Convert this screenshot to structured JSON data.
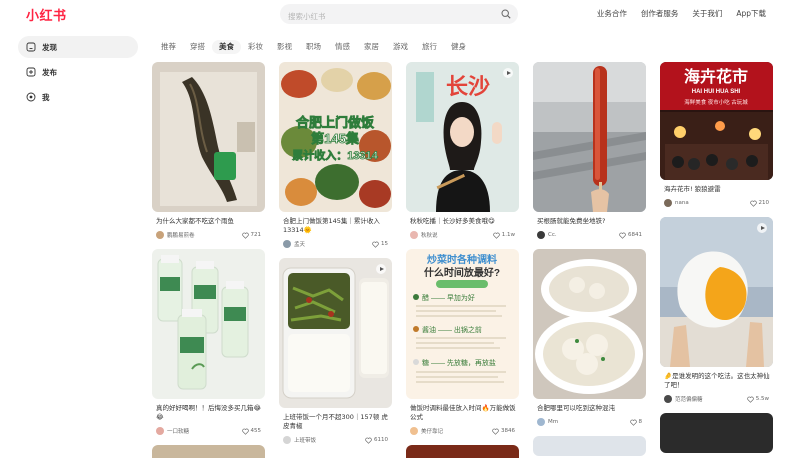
{
  "brand": "小红书",
  "search": {
    "placeholder": "搜索小红书"
  },
  "topnav": [
    "业务合作",
    "创作者服务",
    "关于我们",
    "App下载"
  ],
  "sidebar": [
    {
      "label": "发现",
      "icon": "home-icon",
      "active": true
    },
    {
      "label": "发布",
      "icon": "plus-square-icon",
      "active": false
    },
    {
      "label": "我",
      "icon": "user-icon",
      "active": false
    }
  ],
  "tabs": [
    "推荐",
    "穿搭",
    "美食",
    "彩妆",
    "影视",
    "职场",
    "情感",
    "家居",
    "游戏",
    "旅行",
    "健身"
  ],
  "active_tab": "美食",
  "cards": [
    {
      "title": "为什么大家都不吃这个雨鱼",
      "author": "鹏鹏易煎卷",
      "likes": "721"
    },
    {
      "title": "合肥上门做饭第145集｜累计收入13314🌞",
      "author": "孟天",
      "likes": "15",
      "thumb_texts": [
        "合肥上门做饭",
        "第145集",
        "累计收入：13314"
      ]
    },
    {
      "title": "秋秋吃播｜长沙好多美食哦😋",
      "author": "秋秋说",
      "likes": "1.1w",
      "thumb_texts": [
        "长沙"
      ],
      "video": true
    },
    {
      "title": "买根肠就能免费坐地铁?",
      "author": "Cc.",
      "likes": "6841"
    },
    {
      "title": "海卉花市! 狼狼避雷",
      "author": "nana",
      "likes": "210",
      "thumb_texts": [
        "海卉花市",
        "HAI HUI HUA SHI",
        "海鲜美食 夜市小吃 古玩城"
      ]
    },
    {
      "title": "真的好好喝啊！！后悔没多买几箱😂😂",
      "author": "一口软糖",
      "likes": "455"
    },
    {
      "title": "上班带饭一个月不超300｜157顿 虎皮青椒",
      "author": "上班带饭",
      "likes": "6110",
      "video": true
    },
    {
      "title": "做饭时调料最佳放入时间🔥万能做饭公式",
      "author": "美仔靠记",
      "likes": "3846",
      "thumb_texts": [
        "炒菜时各种调料",
        "什么时间放最好?",
        "醋 —— 早加为好",
        "酱油 —— 出锅之前",
        "糖 —— 先放糖，再放盐"
      ]
    },
    {
      "title": "合肥哪里可以吃到这种混沌",
      "author": "Mm",
      "likes": "8"
    },
    {
      "title": "🤌是谁发明的这个吃法。这也太神仙了吧！",
      "author": "范范偏偏糖",
      "likes": "5.5w",
      "video": true
    }
  ]
}
